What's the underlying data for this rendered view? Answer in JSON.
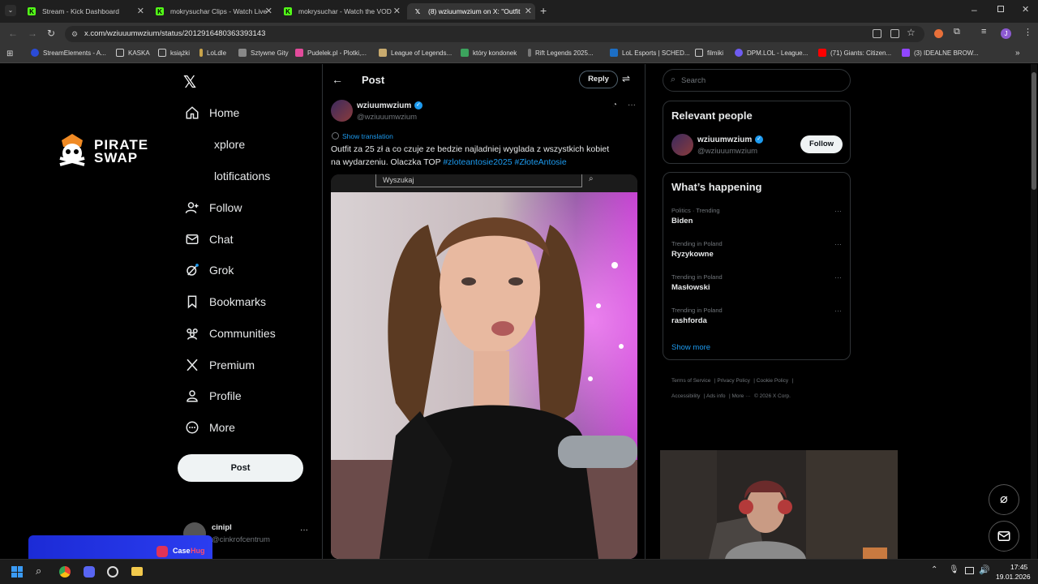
{
  "browser": {
    "tabs": [
      {
        "title": "Stream - Kick Dashboard",
        "icon": "kick-icon"
      },
      {
        "title": "mokrysuchar Clips - Watch Live",
        "icon": "kick-icon"
      },
      {
        "title": "mokrysuchar - Watch the VOD",
        "icon": "kick-icon"
      },
      {
        "title": "(8) wziuumwzium on X: \"Outfit",
        "icon": "x-icon"
      }
    ],
    "url": "x.com/wziuuumwzium/status/2012916480363393143",
    "bookmarks": [
      "StreamElements - A...",
      "KASKA",
      "książki",
      "LoLdle",
      "Sztywne Gity",
      "Pudelek.pl - Plotki,...",
      "League of Legends...",
      "który kondonek",
      "Rift Legends 2025...",
      "LoL Esports | SCHED...",
      "filmiki",
      "DPM.LOL - League...",
      "(71) Giants: Citizen...",
      "(3) IDEALNE BROW..."
    ]
  },
  "sidebar": {
    "logo_text_line1": "PIRATE",
    "logo_text_line2": "SWAP",
    "nav": [
      {
        "label": "Home",
        "icon": "home-icon"
      },
      {
        "label": "xplore",
        "icon": "explore-icon"
      },
      {
        "label": "lotifications",
        "icon": "bell-icon"
      },
      {
        "label": "Follow",
        "icon": "follow-icon"
      },
      {
        "label": "Chat",
        "icon": "mail-icon"
      },
      {
        "label": "Grok",
        "icon": "grok-icon"
      },
      {
        "label": "Bookmarks",
        "icon": "bookmark-icon"
      },
      {
        "label": "Communities",
        "icon": "communities-icon"
      },
      {
        "label": "Premium",
        "icon": "x-icon"
      },
      {
        "label": "Profile",
        "icon": "profile-icon"
      },
      {
        "label": "More",
        "icon": "more-icon"
      }
    ],
    "post_button": "Post",
    "account": {
      "name": "cinipl",
      "handle": "@cinkrofcentrum"
    },
    "casehug": {
      "text": "Case",
      "text2": "Hug"
    }
  },
  "post": {
    "header": "Post",
    "reply_button": "Reply",
    "author_name": "wziuumwzium",
    "author_handle": "@wziuuumwzium",
    "show_translation": "Show translation",
    "text_line1": "Outfit za 25 zł a co czuje ze bedzie najladniej wyglada z wszystkich kobiet",
    "text_line2": "na wydarzeniu. Olaczka TOP",
    "hashtag1": "#zloteantosie2025",
    "hashtag2": "#ZłoteAntosie",
    "media_search": "Wyszukaj"
  },
  "right": {
    "search_placeholder": "Search",
    "relevant_title": "Relevant people",
    "relevant_name": "wziuumwzium",
    "relevant_handle": "@wziuuumwzium",
    "follow_button": "Follow",
    "happening_title": "What’s happening",
    "trends": [
      {
        "category": "Politics · Trending",
        "name": "Biden"
      },
      {
        "category": "Trending in Poland",
        "name": "Ryzykowne"
      },
      {
        "category": "Trending in Poland",
        "name": "Masłowski"
      },
      {
        "category": "Trending in Poland",
        "name": "rashforda"
      }
    ],
    "show_more": "Show more",
    "footer": [
      "Terms of Service",
      "Privacy Policy",
      "Cookie Policy",
      "Accessibility",
      "Ads info",
      "More ···",
      "© 2026 X Corp."
    ]
  },
  "taskbar": {
    "time": "17:45",
    "date": "19.01.2026"
  },
  "colors": {
    "accent": "#1d9bf0",
    "kick": "#53fc18",
    "bg": "#000000"
  }
}
